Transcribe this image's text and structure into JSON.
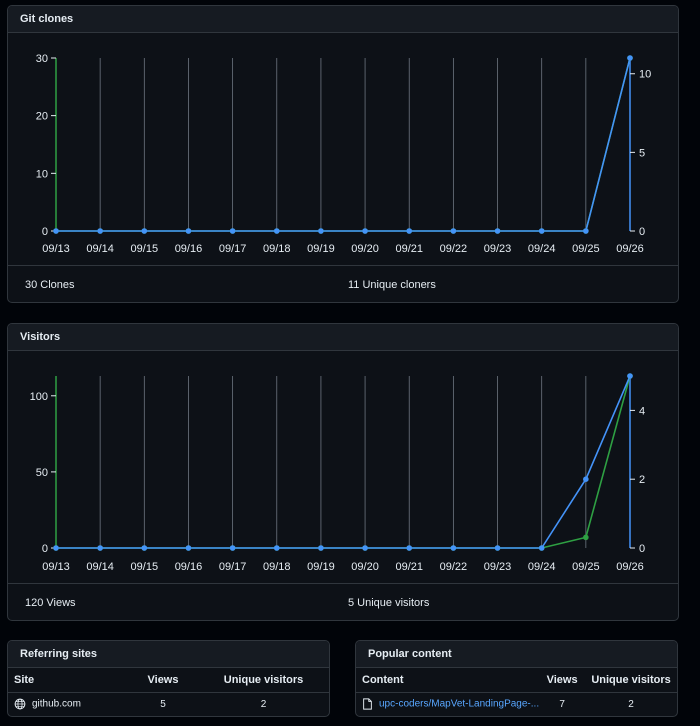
{
  "clones": {
    "title": "Git clones",
    "summary_left": "30 Clones",
    "summary_right": "11 Unique cloners"
  },
  "visitors": {
    "title": "Visitors",
    "summary_left": "120 Views",
    "summary_right": "5 Unique visitors"
  },
  "referring": {
    "title": "Referring sites",
    "col_site": "Site",
    "col_views": "Views",
    "col_unique": "Unique visitors",
    "rows": [
      {
        "site": "github.com",
        "views": "5",
        "unique": "2"
      }
    ]
  },
  "popular": {
    "title": "Popular content",
    "col_content": "Content",
    "col_views": "Views",
    "col_unique": "Unique visitors",
    "rows": [
      {
        "content": "upc-coders/MapVet-LandingPage-...",
        "views": "7",
        "unique": "2"
      }
    ]
  },
  "colors": {
    "green": "#2ea043",
    "blue": "#4493f8",
    "grid": "#6e7681"
  },
  "chart_data": [
    {
      "type": "line",
      "x": [
        "09/13",
        "09/14",
        "09/15",
        "09/16",
        "09/17",
        "09/18",
        "09/19",
        "09/20",
        "09/21",
        "09/22",
        "09/23",
        "09/24",
        "09/25",
        "09/26"
      ],
      "series": [
        {
          "axis": "left",
          "color": "#2ea043",
          "values": [
            0,
            0,
            0,
            0,
            0,
            0,
            0,
            0,
            0,
            0,
            0,
            0,
            0,
            30
          ]
        },
        {
          "axis": "right",
          "color": "#4493f8",
          "values": [
            0,
            0,
            0,
            0,
            0,
            0,
            0,
            0,
            0,
            0,
            0,
            0,
            0,
            11
          ]
        }
      ],
      "ylim_left": [
        0,
        30
      ],
      "yticks_left": [
        0,
        10,
        20,
        30
      ],
      "ylim_right": [
        0,
        11
      ],
      "yticks_right": [
        0,
        5,
        10
      ],
      "grid": true
    },
    {
      "type": "line",
      "x": [
        "09/13",
        "09/14",
        "09/15",
        "09/16",
        "09/17",
        "09/18",
        "09/19",
        "09/20",
        "09/21",
        "09/22",
        "09/23",
        "09/24",
        "09/25",
        "09/26"
      ],
      "series": [
        {
          "axis": "left",
          "color": "#2ea043",
          "values": [
            0,
            0,
            0,
            0,
            0,
            0,
            0,
            0,
            0,
            0,
            0,
            0,
            7,
            113
          ]
        },
        {
          "axis": "right",
          "color": "#4493f8",
          "values": [
            0,
            0,
            0,
            0,
            0,
            0,
            0,
            0,
            0,
            0,
            0,
            0,
            2,
            5
          ]
        }
      ],
      "ylim_left": [
        0,
        113
      ],
      "yticks_left": [
        0,
        50,
        100
      ],
      "ylim_right": [
        0,
        5
      ],
      "yticks_right": [
        0,
        2,
        4
      ],
      "grid": true
    }
  ]
}
